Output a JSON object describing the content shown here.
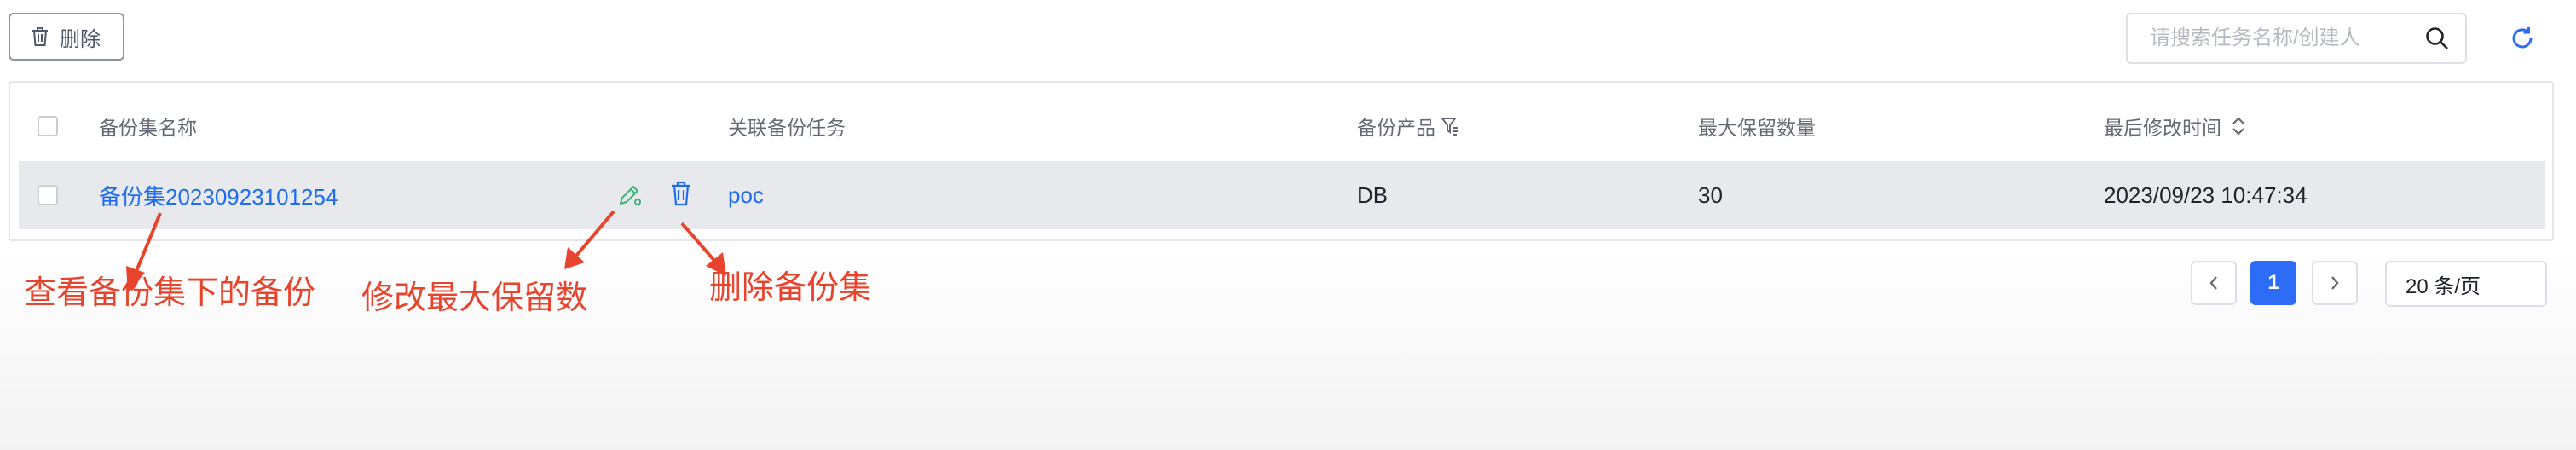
{
  "toolbar": {
    "delete_label": "删除",
    "delete_icon": "trash-icon"
  },
  "search": {
    "placeholder": "请搜索任务名称/创建人",
    "value": "",
    "icon": "search-icon"
  },
  "refresh_icon": "refresh-icon",
  "table": {
    "columns": [
      "备份集名称",
      "关联备份任务",
      "备份产品",
      "最大保留数量",
      "最后修改时间"
    ],
    "rows": [
      {
        "name": "备份集20230923101254",
        "task": "poc",
        "product": "DB",
        "max_keep": "30",
        "modified": "2023/09/23 10:47:34"
      }
    ]
  },
  "pagination": {
    "current": "1",
    "page_size": "20 条/页"
  },
  "annotations": {
    "view": "查看备份集下的备份",
    "edit": "修改最大保留数",
    "delete": "删除备份集"
  },
  "colors": {
    "link": "#1f6cf0",
    "annotation": "#e8432c",
    "edit_icon": "#3ab37a",
    "primary": "#2d6cf6"
  }
}
